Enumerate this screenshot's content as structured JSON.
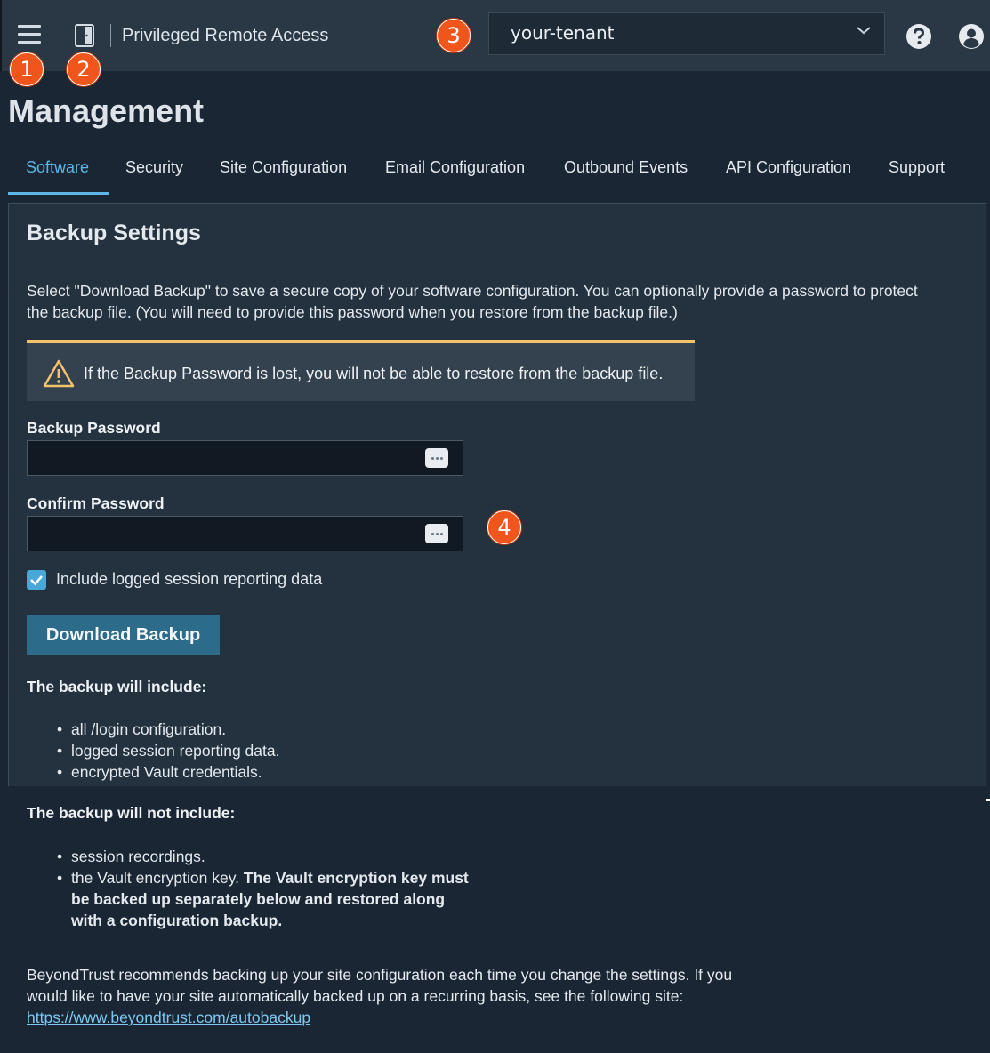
{
  "header": {
    "app_title": "Privileged Remote Access",
    "tenant": "your-tenant",
    "icons": [
      "hamburger-icon",
      "app-door-icon",
      "chevron-down-icon",
      "help-icon",
      "user-avatar-icon"
    ]
  },
  "callouts": [
    "1",
    "2",
    "3",
    "4"
  ],
  "page": {
    "title": "Management",
    "tabs": [
      {
        "label": "Software",
        "active": true
      },
      {
        "label": "Security"
      },
      {
        "label": "Site Configuration"
      },
      {
        "label": "Email Configuration"
      },
      {
        "label": "Outbound Events"
      },
      {
        "label": "API Configuration"
      },
      {
        "label": "Support"
      }
    ]
  },
  "backup": {
    "heading": "Backup Settings",
    "intro": "Select \"Download Backup\" to save a secure copy of your software configuration. You can optionally provide a password to protect the backup file. (You will need to provide this password when you restore from the backup file.)",
    "warning": "If the Backup Password is lost, you will not be able to restore from the backup file.",
    "password_label": "Backup Password",
    "confirm_label": "Confirm Password",
    "include_label": "Include logged session reporting data",
    "include_checked": true,
    "download_label": "Download Backup",
    "includes_heading": "The backup will include:",
    "includes": [
      "all /login configuration.",
      "logged session reporting data.",
      "encrypted Vault credentials."
    ],
    "excludes_heading": "The backup will not include:",
    "excludes_1": "session recordings.",
    "excludes_2_plain": "the Vault encryption key. ",
    "excludes_2_bold": "The Vault encryption key must be backed up separately below and restored along with a configuration backup.",
    "footer_text": "BeyondTrust recommends backing up your site configuration each time you change the settings. If you would like to have your site automatically backed up on a recurring basis, see the following site: ",
    "footer_link": "https://www.beyondtrust.com/autobackup"
  },
  "colors": {
    "accent": "#5fb6e6",
    "callout": "#f0561b",
    "warning_border": "#f2c36b",
    "button": "#2c6b89"
  }
}
